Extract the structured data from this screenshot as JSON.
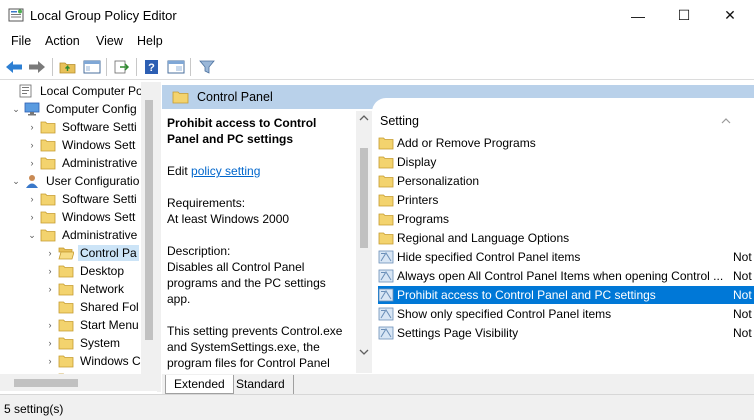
{
  "window": {
    "title": "Local Group Policy Editor",
    "minimize": "—",
    "maximize": "☐",
    "close": "✕"
  },
  "menu": [
    "File",
    "Action",
    "View",
    "Help"
  ],
  "toolbar": {
    "icons": [
      "back-arrow-icon",
      "forward-arrow-icon",
      "up-folder-icon",
      "show-hide-tree-icon",
      "export-list-icon",
      "help-icon",
      "properties-icon",
      "filter-icon"
    ]
  },
  "tree": {
    "items": [
      {
        "label": "Local Computer Polic",
        "caret": "",
        "icon": "policy-icon"
      },
      {
        "label": "Computer Config",
        "caret": "⌄",
        "icon": "computer-icon"
      },
      {
        "label": "Software Setti",
        "caret": "›",
        "icon": "folder-icon"
      },
      {
        "label": "Windows Sett",
        "caret": "›",
        "icon": "folder-icon"
      },
      {
        "label": "Administrative",
        "caret": "›",
        "icon": "folder-icon"
      },
      {
        "label": "User Configuratio",
        "caret": "⌄",
        "icon": "user-icon"
      },
      {
        "label": "Software Setti",
        "caret": "›",
        "icon": "folder-icon"
      },
      {
        "label": "Windows Sett",
        "caret": "›",
        "icon": "folder-icon"
      },
      {
        "label": "Administrative",
        "caret": "⌄",
        "icon": "folder-icon"
      },
      {
        "label": "Control Pa",
        "caret": "›",
        "icon": "folder-open-icon"
      },
      {
        "label": "Desktop",
        "caret": "›",
        "icon": "folder-icon"
      },
      {
        "label": "Network",
        "caret": "›",
        "icon": "folder-icon"
      },
      {
        "label": "Shared Fol",
        "caret": "",
        "icon": "folder-icon"
      },
      {
        "label": "Start Menu",
        "caret": "›",
        "icon": "folder-icon"
      },
      {
        "label": "System",
        "caret": "›",
        "icon": "folder-icon"
      },
      {
        "label": "Windows C",
        "caret": "›",
        "icon": "folder-icon"
      },
      {
        "label": "",
        "caret": "",
        "icon": "folder-icon"
      }
    ],
    "selected_index": 9
  },
  "right_pane": {
    "header": "Control Panel",
    "description": {
      "title": "Prohibit access to Control Panel and PC settings",
      "edit_prefix": "Edit",
      "edit_link": "policy setting",
      "requirements_label": "Requirements:",
      "requirements_value": "At least Windows 2000",
      "description_label": "Description:",
      "description_text": "Disables all Control Panel programs and the PC settings app.",
      "extra_text": "This setting prevents Control.exe and SystemSettings.exe, the program files for Control Panel and PC settings, from starting. As a result, users cannot start Control"
    },
    "list": {
      "column_header": "Setting",
      "items": [
        {
          "label": "Add or Remove Programs",
          "icon": "folder-icon",
          "state": ""
        },
        {
          "label": "Display",
          "icon": "folder-icon",
          "state": ""
        },
        {
          "label": "Personalization",
          "icon": "folder-icon",
          "state": ""
        },
        {
          "label": "Printers",
          "icon": "folder-icon",
          "state": ""
        },
        {
          "label": "Programs",
          "icon": "folder-icon",
          "state": ""
        },
        {
          "label": "Regional and Language Options",
          "icon": "folder-icon",
          "state": ""
        },
        {
          "label": "Hide specified Control Panel items",
          "icon": "setting-icon",
          "state": "Not"
        },
        {
          "label": "Always open All Control Panel Items when opening Control ...",
          "icon": "setting-icon",
          "state": "Not"
        },
        {
          "label": "Prohibit access to Control Panel and PC settings",
          "icon": "setting-icon",
          "state": "Not"
        },
        {
          "label": "Show only specified Control Panel items",
          "icon": "setting-icon",
          "state": "Not"
        },
        {
          "label": "Settings Page Visibility",
          "icon": "setting-icon",
          "state": "Not"
        }
      ],
      "selected_index": 8
    },
    "tabs": [
      "Extended",
      "Standard"
    ],
    "active_tab": "Extended"
  },
  "status": "5 setting(s)",
  "colors": {
    "header_band": "#b9d1ea",
    "selection": "#0078d7",
    "tree_selection": "#cce4f7",
    "folder": "#e8c15a",
    "link": "#0066cc"
  }
}
